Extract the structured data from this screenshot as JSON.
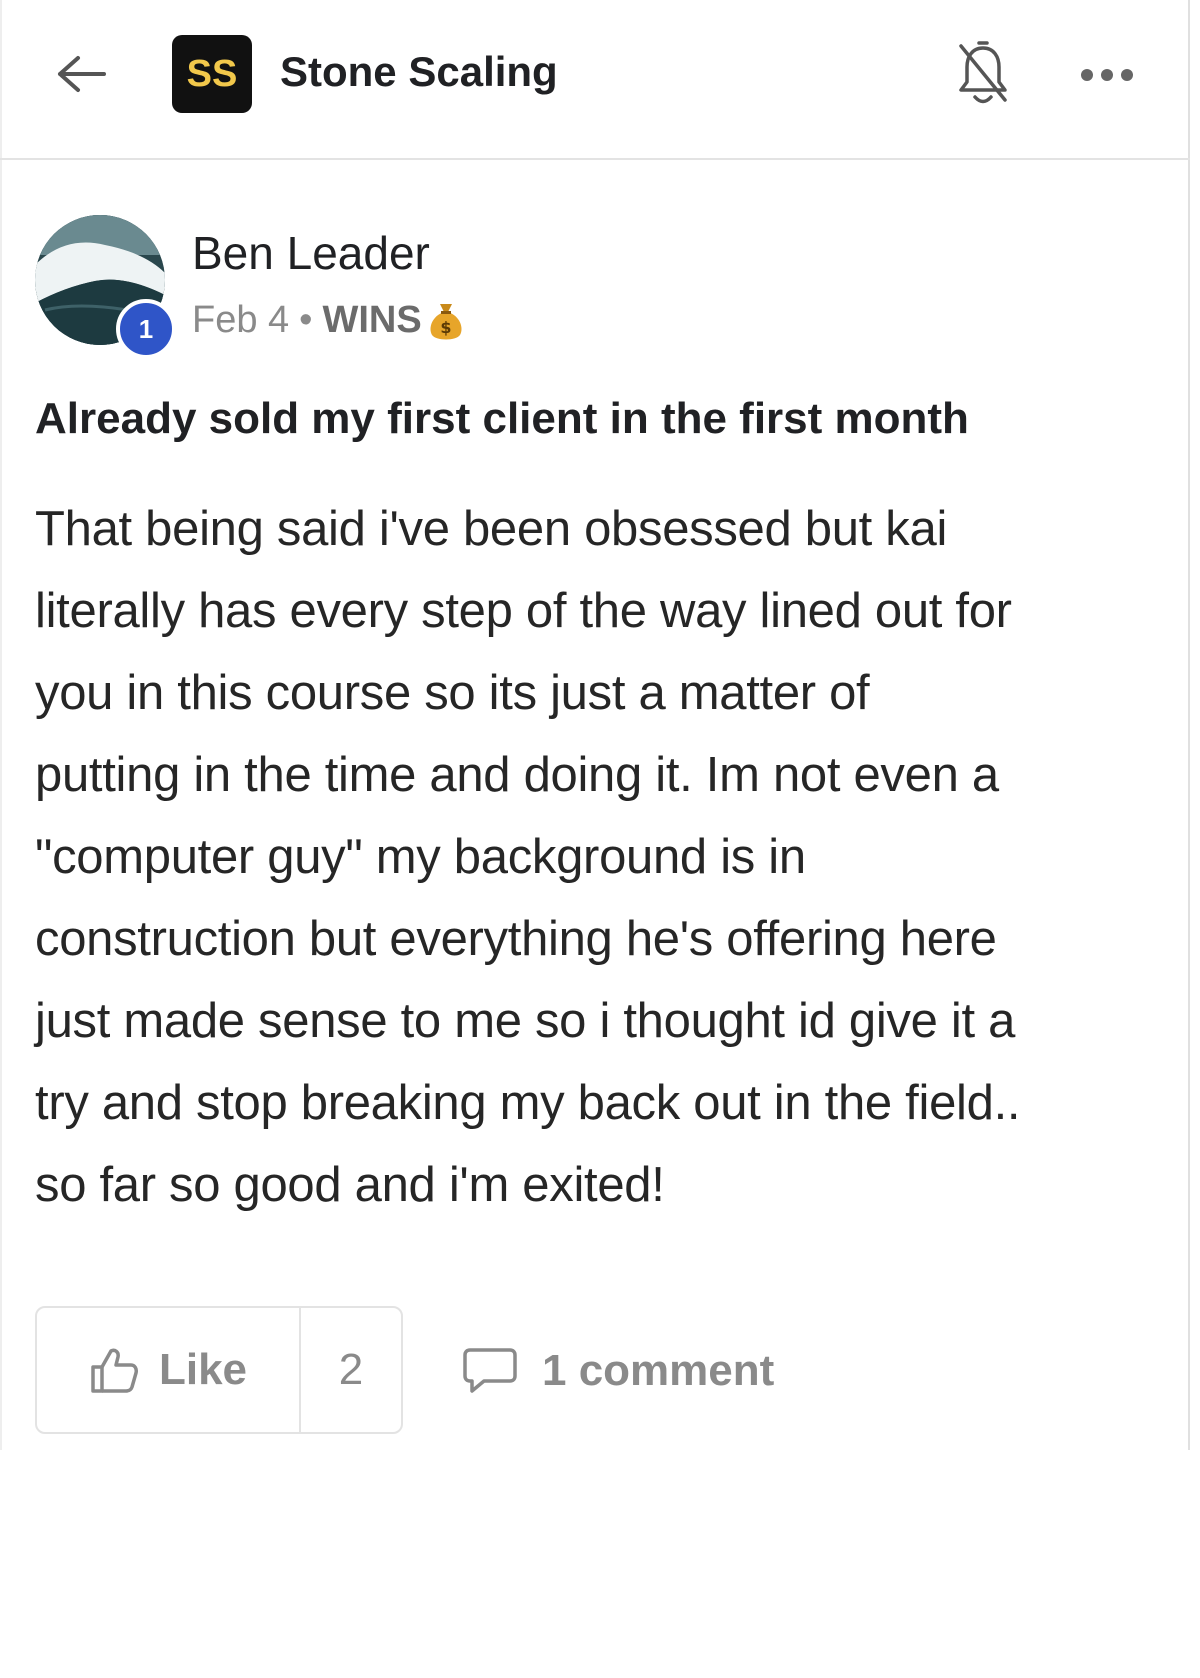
{
  "header": {
    "back_icon": "arrow-left-icon",
    "logo_text": "SS",
    "group_name": "Stone Scaling",
    "notifications_icon": "bell-off-icon",
    "more_icon": "more-horizontal-icon"
  },
  "post": {
    "author": "Ben Leader",
    "level": "1",
    "date": "Feb 4",
    "separator": "•",
    "category": "WINS",
    "category_icon": "money-bag-icon",
    "title": "Already sold my first client in the first month",
    "body_lines": [
      "That being said i've been obsessed but kai",
      "literally has every step of the way lined out for",
      "you in this course so its just a matter of",
      "putting in the time and doing it. Im not even a",
      "\"computer guy\" my background is in",
      "construction but everything he's offering here",
      "just made sense to me so i thought id give it a",
      "try and stop breaking my back out in the field..",
      "so far so good and i'm exited!"
    ]
  },
  "footer": {
    "like_label": "Like",
    "like_count": "2",
    "comment_label": "1 comment"
  },
  "colors": {
    "logo_bg": "#111111",
    "logo_text": "#f2c84b",
    "level_badge": "#2f55c8",
    "muted_text": "#8a8a8a"
  }
}
